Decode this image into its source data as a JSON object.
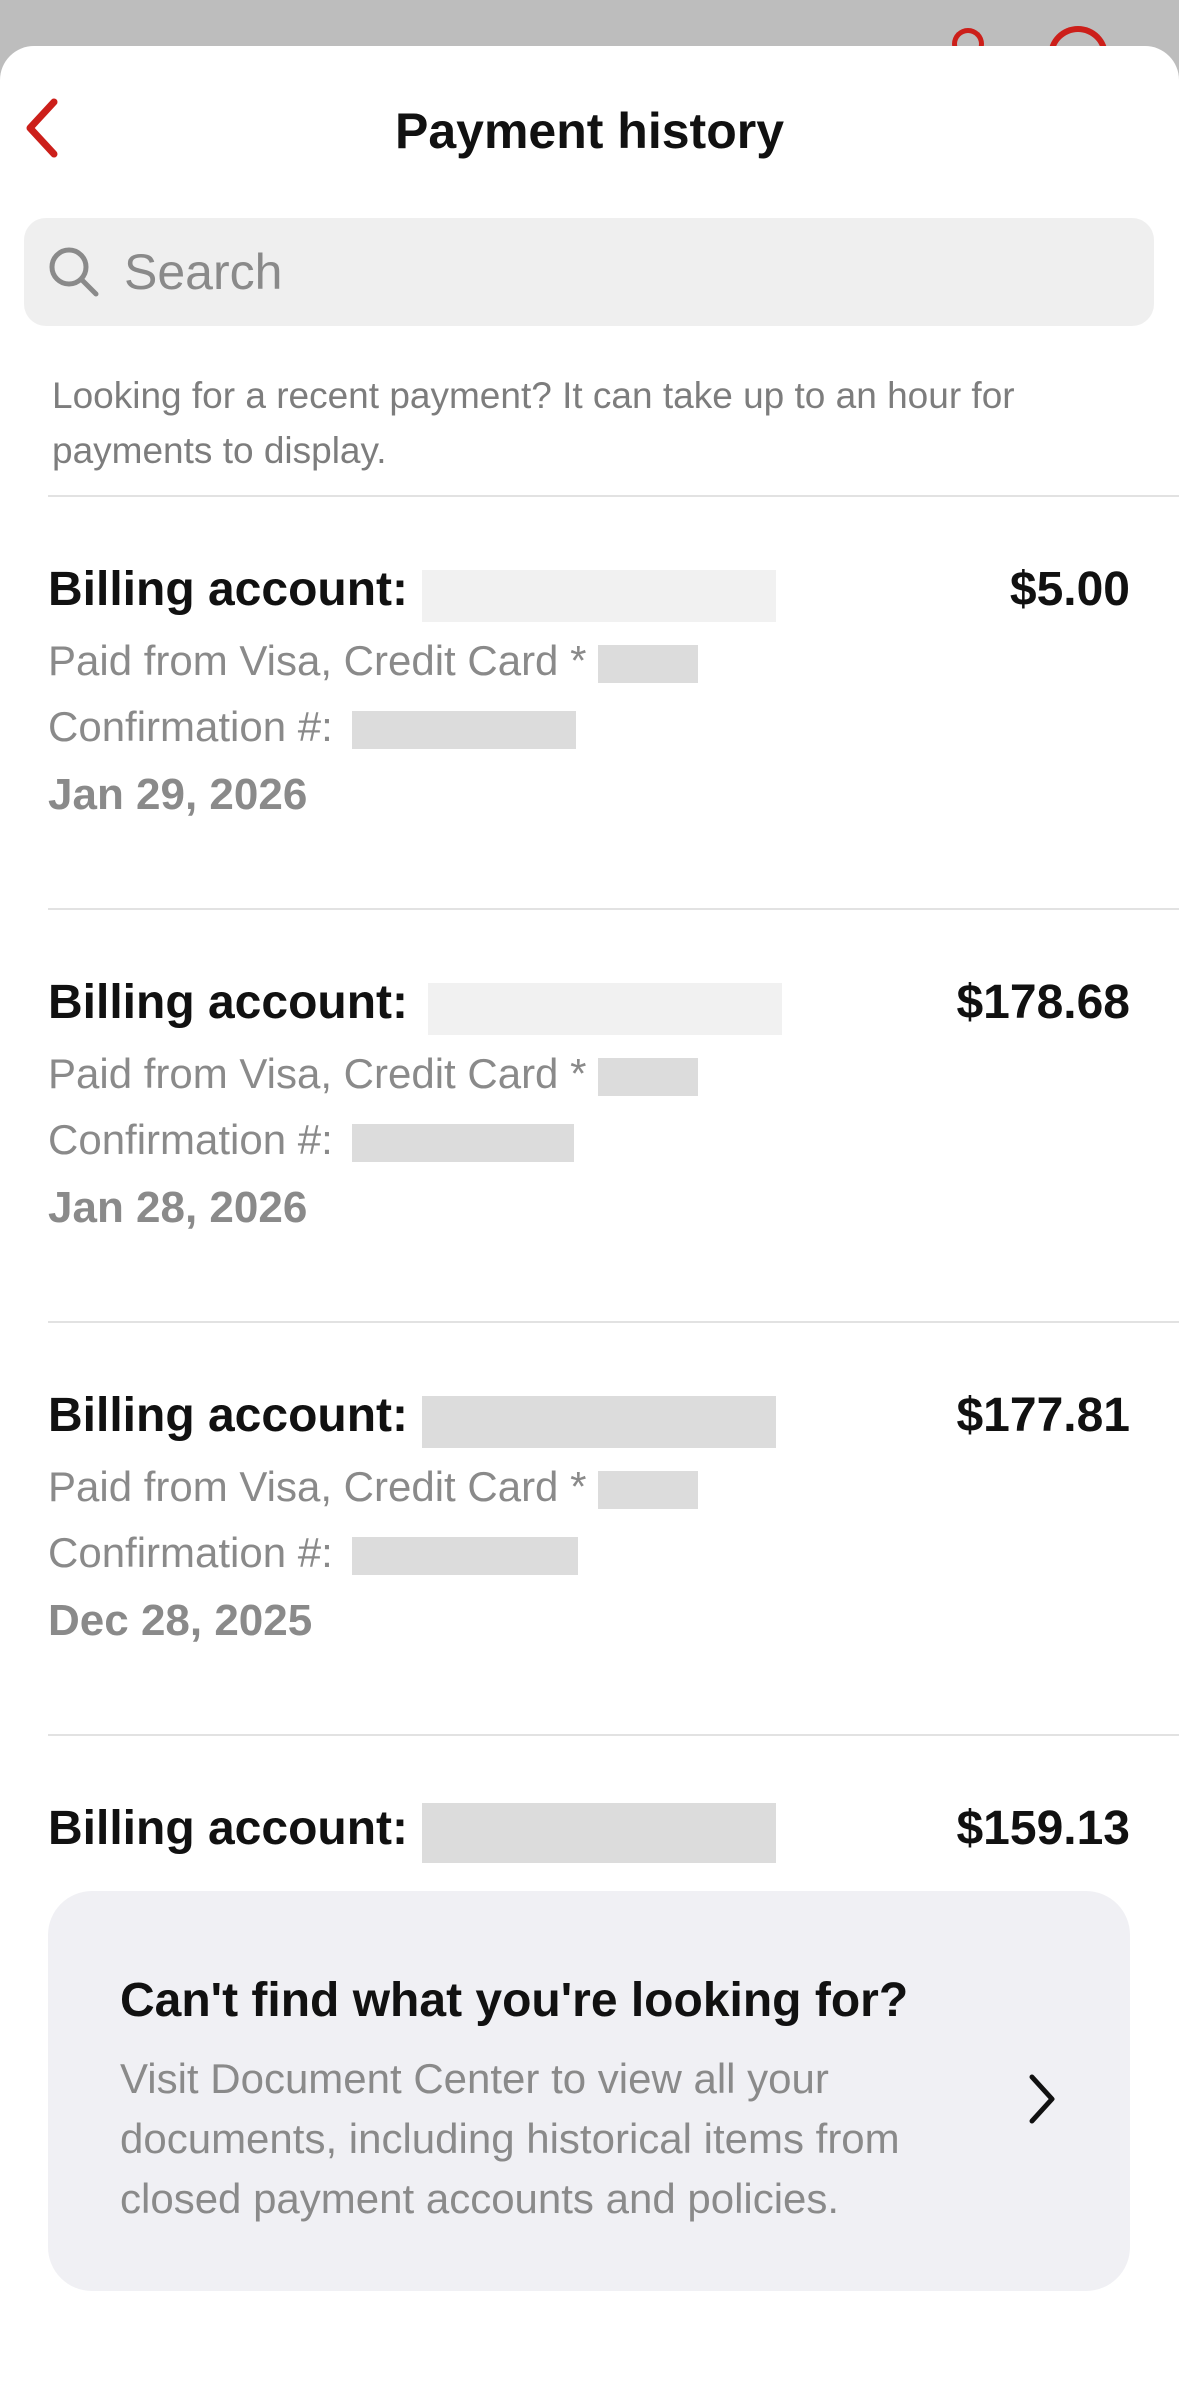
{
  "header": {
    "title": "Payment history"
  },
  "search": {
    "placeholder": "Search"
  },
  "notice": "Looking for a recent payment? It can take up to an hour for payments to display.",
  "payments": [
    {
      "billing_label": "Billing account:",
      "amount": "$5.00",
      "paid_from": "Paid from Visa, Credit Card *",
      "confirmation_label": "Confirmation #:",
      "date": "Jan 29, 2026"
    },
    {
      "billing_label": "Billing account:",
      "amount": "$178.68",
      "paid_from": "Paid from Visa, Credit Card *",
      "confirmation_label": "Confirmation #:",
      "date": "Jan 28, 2026"
    },
    {
      "billing_label": "Billing account:",
      "amount": "$177.81",
      "paid_from": "Paid from Visa, Credit Card *",
      "confirmation_label": "Confirmation #:",
      "date": "Dec 28, 2025"
    },
    {
      "billing_label": "Billing account:",
      "amount": "$159.13"
    }
  ],
  "doc_center": {
    "title": "Can't find what you're looking for?",
    "description": "Visit Document Center to view all your documents, including historical items from closed payment accounts and policies."
  },
  "colors": {
    "accent": "#cc1f1a",
    "muted_text": "#8a8a8a",
    "card_bg": "#f0f0f4"
  },
  "icons": {
    "back": "chevron-left-icon",
    "search": "search-icon",
    "doc_center": "chevron-right-icon"
  }
}
